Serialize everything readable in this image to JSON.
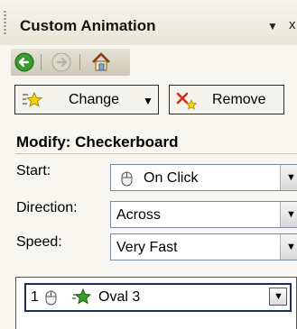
{
  "pane": {
    "title": "Custom Animation",
    "menu_arrow": "▼",
    "close_glyph": "x"
  },
  "nav": {
    "back_icon": "back-arrow-icon",
    "forward_icon": "forward-arrow-icon",
    "home_icon": "home-icon"
  },
  "toolbar": {
    "change_label": "Change",
    "change_icon": "star-effect-icon",
    "change_arrow": "▼",
    "remove_label": "Remove",
    "remove_icon": "remove-effect-icon"
  },
  "modify": {
    "heading": "Modify: Checkerboard",
    "fields": [
      {
        "label": "Start:",
        "value": "On Click",
        "icon": "mouse-icon"
      },
      {
        "label": "Direction:",
        "value": "Across"
      },
      {
        "label": "Speed:",
        "value": "Very Fast"
      }
    ],
    "dropdown_arrow": "▼"
  },
  "animation_list": {
    "items": [
      {
        "number": "1",
        "name": "Oval 3",
        "trigger_icon": "mouse-icon",
        "effect_icon": "entrance-star-icon"
      }
    ]
  },
  "colors": {
    "pane_bg": "#f7f6f0",
    "list_selection_border": "#1c2e5a",
    "nav_back_green": "#3a9b2e",
    "remove_red": "#d42a1a",
    "star_yellow": "#f4d21a"
  }
}
